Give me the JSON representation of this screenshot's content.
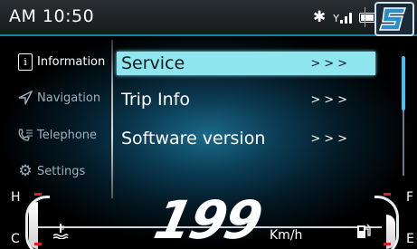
{
  "status": {
    "clock": "AM 10:50",
    "bluetooth_icon": "bluetooth-icon",
    "signal_icon": "signal-bars-icon",
    "battery_icon": "battery-icon",
    "logo_icon": "brand-logo-icon"
  },
  "sidebar": {
    "items": [
      {
        "label": "Information",
        "icon": "information-icon",
        "active": true
      },
      {
        "label": "Navigation",
        "icon": "navigation-arrow-icon",
        "active": false
      },
      {
        "label": "Telephone",
        "icon": "telephone-icon",
        "active": false
      },
      {
        "label": "Settings",
        "icon": "gear-icon",
        "active": false
      }
    ]
  },
  "menu": {
    "items": [
      {
        "label": "Service",
        "arrow": ">>>",
        "selected": true
      },
      {
        "label": "Trip Info",
        "arrow": ">>>",
        "selected": false
      },
      {
        "label": "Software version",
        "arrow": ">>>",
        "selected": false
      }
    ]
  },
  "gauges": {
    "temp": {
      "high_label": "H",
      "low_label": "C",
      "icon": "coolant-temperature-icon"
    },
    "fuel": {
      "full_label": "F",
      "empty_label": "E",
      "icon": "fuel-pump-icon"
    },
    "speed": "199",
    "speed_unit": "Km/h"
  },
  "colors": {
    "accent": "#1c7fa3",
    "selection": "#8fe6ef",
    "warning_tick": "#e0201a"
  }
}
